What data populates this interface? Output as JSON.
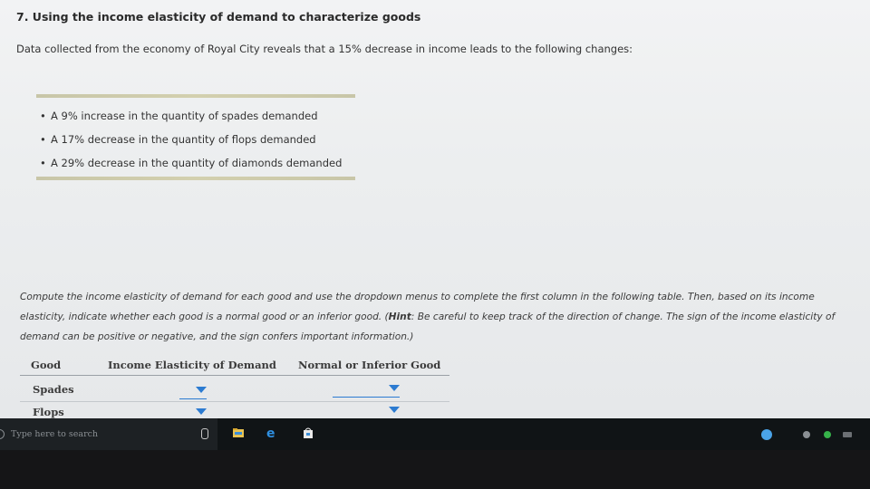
{
  "question": {
    "title": "7. Using the income elasticity of demand to characterize goods",
    "intro": "Data collected from the economy of Royal City reveals that a 15% decrease in income leads to the following changes:",
    "bullets": [
      "A 9% increase in the quantity of spades demanded",
      "A 17% decrease in the quantity of flops demanded",
      "A 29% decrease in the quantity of diamonds demanded"
    ],
    "instructions_part1": "Compute the income elasticity of demand for each good and use the dropdown menus to complete the first column in the following table. Then, based on its income elasticity, indicate whether each good is a normal good or an inferior good. (",
    "hint_label": "Hint",
    "instructions_part2": ": Be careful to keep track of the direction of change. The sign of the income elasticity of demand can be positive or negative, and the sign confers important information.)"
  },
  "table": {
    "headers": [
      "Good",
      "Income Elasticity of Demand",
      "Normal or Inferior Good"
    ],
    "rows": [
      {
        "good": "Spades",
        "elasticity": "",
        "type": ""
      },
      {
        "good": "Flops",
        "elasticity": "",
        "type": ""
      }
    ]
  },
  "taskbar": {
    "search_placeholder": "Type here to search",
    "icons": [
      "search-icon",
      "microphone-icon",
      "file-explorer-icon",
      "edge-icon",
      "store-icon"
    ],
    "tray_icons": [
      "help-icon",
      "chevron-up-icon",
      "network-icon",
      "status-icon",
      "battery-icon"
    ]
  },
  "colors": {
    "dropdown_accent": "#2c7bd1",
    "taskbar": "#101416"
  }
}
